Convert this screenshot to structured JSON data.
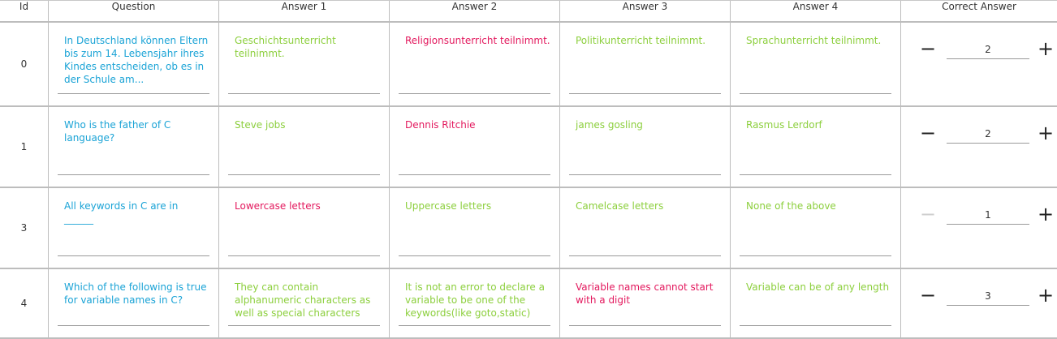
{
  "headers": [
    "Id",
    "Question",
    "Answer 1",
    "Answer 2",
    "Answer 3",
    "Answer 4",
    "Correct Answer"
  ],
  "colors": {
    "correct": "#e3195e",
    "wrong": "#8ccf3d",
    "question": "#1aa3d6",
    "disabled": "#cfcfcf"
  },
  "rows": [
    {
      "id": "0",
      "question": "In Deutschland können Eltern bis zum 14. Lebensjahr ihres Kindes entscheiden, ob es in der Schule am...",
      "answers": [
        "Geschichtsunterricht teilnimmt.",
        "Religionsunterricht teilnimmt.",
        "Politikunterricht teilnimmt.",
        "Sprachunterricht teilnimmt."
      ],
      "correct": "2",
      "minus_disabled": false
    },
    {
      "id": "1",
      "question": "Who is the father of C language?",
      "answers": [
        "Steve jobs",
        "Dennis Ritchie",
        "james gosling",
        "Rasmus Lerdorf"
      ],
      "correct": "2",
      "minus_disabled": false
    },
    {
      "id": "3",
      "question": "All keywords in C are in ______",
      "answers": [
        "Lowercase letters",
        "Uppercase letters",
        "Camelcase letters",
        "None of the above"
      ],
      "correct": "1",
      "minus_disabled": true
    },
    {
      "id": "4",
      "question": "Which of the following is true for variable names in C?",
      "answers": [
        "They can contain alphanumeric characters as well as special characters",
        "It is not an error to declare a variable to be one of the keywords(like goto,static)",
        "Variable names cannot start with a digit",
        "Variable can be of any length"
      ],
      "correct": "3",
      "minus_disabled": false
    }
  ],
  "icons": {
    "minus": "minus-icon",
    "plus": "plus-icon"
  },
  "glyphs": {
    "minus": "−",
    "plus": "+"
  }
}
